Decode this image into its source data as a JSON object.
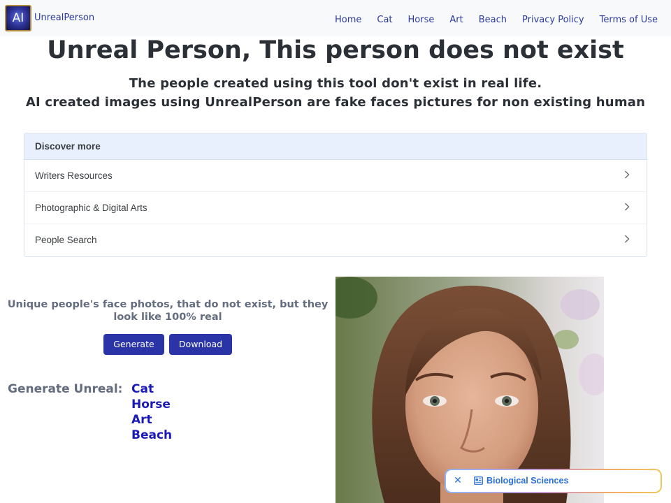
{
  "navbar": {
    "logo_text": "AI",
    "brand": "UnrealPerson",
    "links": [
      "Home",
      "Cat",
      "Horse",
      "Art",
      "Beach",
      "Privacy Policy",
      "Terms of Use"
    ]
  },
  "hero": {
    "title": "Unreal Person, This person does not exist",
    "subtitle_line1": "The people created using this tool don't exist in real life.",
    "subtitle_line2": "AI created images using UnrealPerson are fake faces pictures for non existing human"
  },
  "discover": {
    "header": "Discover more",
    "items": [
      "Writers Resources",
      "Photographic & Digital Arts",
      "People Search"
    ],
    "item_icon": "chevron-right-icon"
  },
  "main": {
    "tagline": "Unique people's face photos, that do not exist, but they look like 100% real",
    "generate_button": "Generate",
    "download_button": "Download",
    "generate_label": "Generate Unreal:",
    "generate_links": [
      "Cat",
      "Horse",
      "Art",
      "Beach"
    ]
  },
  "pill": {
    "close_icon": "close-icon",
    "topic_icon": "newspaper-icon",
    "label": "Biological Sciences"
  },
  "colors": {
    "accent": "#2a34a6",
    "link": "#2c3a9a",
    "generate_link": "#1a1ab8",
    "discover_header_bg": "#e8f0fe"
  }
}
